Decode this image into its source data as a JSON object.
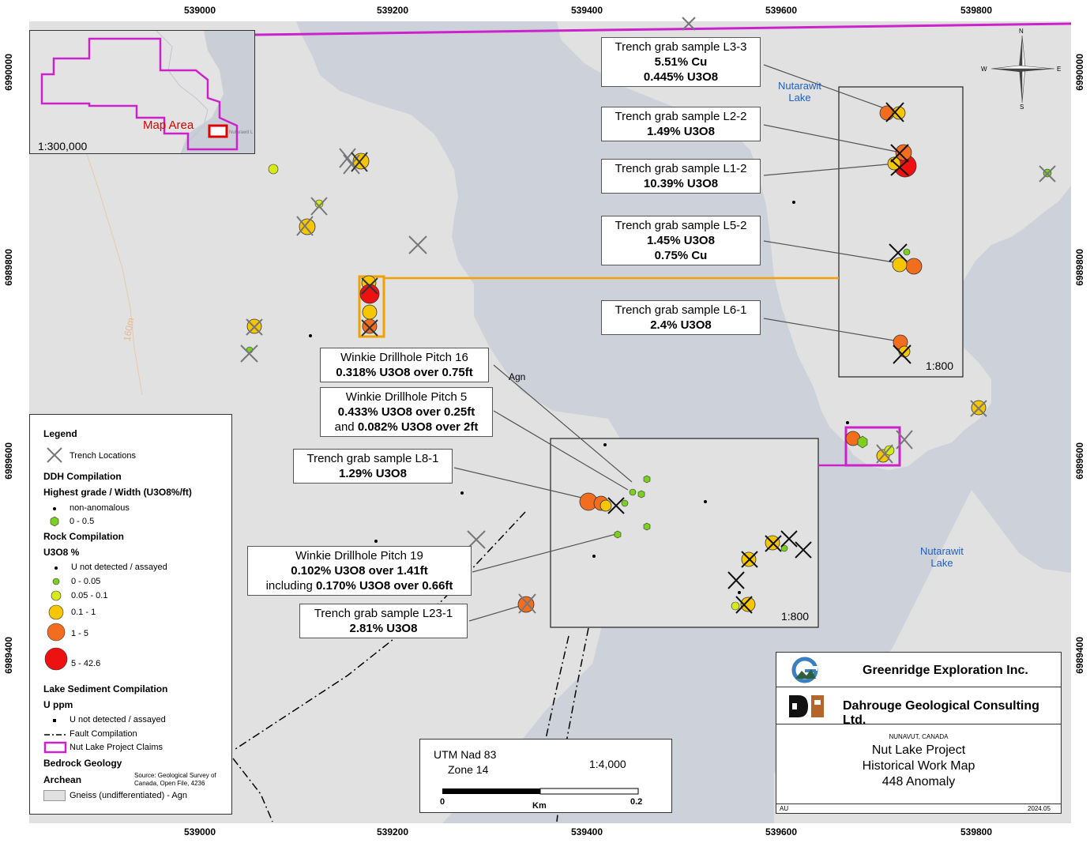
{
  "map": {
    "axis_x_labels": [
      "539000",
      "539200",
      "539400",
      "539600",
      "539800"
    ],
    "axis_y_labels": [
      "6990000",
      "6989800",
      "6989600",
      "6989400"
    ],
    "geology_label": "Agn",
    "contour_label": "160m",
    "lake_labels": [
      {
        "line1": "Nutarawit",
        "line2": "Lake"
      },
      {
        "line1": "Nutarawit",
        "line2": "Lake"
      }
    ],
    "inset_scale_1": "1:800",
    "inset_scale_2": "1:800"
  },
  "callouts": {
    "l3_3": {
      "title": "Trench grab sample L3-3",
      "line1": "5.51% Cu",
      "line2": "0.445% U3O8"
    },
    "l2_2": {
      "title": "Trench grab sample L2-2",
      "line1": "1.49% U3O8"
    },
    "l1_2": {
      "title": "Trench grab sample L1-2",
      "line1": "10.39% U3O8"
    },
    "l5_2": {
      "title": "Trench grab sample L5-2",
      "line1": "1.45% U3O8",
      "line2": "0.75% Cu"
    },
    "l6_1": {
      "title": "Trench grab sample L6-1",
      "line1": "2.4% U3O8"
    },
    "pitch16": {
      "title": "Winkie Drillhole Pitch 16",
      "line1": "0.318% U3O8 over 0.75ft"
    },
    "pitch5": {
      "title": "Winkie Drillhole Pitch 5",
      "line1": "0.433% U3O8 over 0.25ft",
      "line2_prefix": "and ",
      "line2_bold": "0.082% U3O8 over 2ft"
    },
    "l8_1": {
      "title": "Trench grab sample L8-1",
      "line1": "1.29% U3O8"
    },
    "pitch19": {
      "title": "Winkie Drillhole Pitch 19",
      "line1": "0.102% U3O8 over 1.41ft",
      "line2_prefix": "including ",
      "line2_bold": "0.170% U3O8 over 0.66ft"
    },
    "l23_1": {
      "title": "Trench grab sample L23-1",
      "line1": "2.81% U3O8"
    }
  },
  "inset_map": {
    "area_label": "Map Area",
    "scale": "1:300,000",
    "lake_label": "Nutarawit L"
  },
  "north_arrow": {
    "n": "N",
    "s": "S",
    "e": "E",
    "w": "W"
  },
  "legend": {
    "title": "Legend",
    "trench": "Trench Locations",
    "ddh_header": "DDH Compilation",
    "ddh_sub": "Highest grade / Width (U3O8%/ft)",
    "ddh_items": [
      "non-anomalous",
      "0 - 0.5"
    ],
    "rock_header": "Rock Compilation",
    "rock_sub": "U3O8 %",
    "rock_items": [
      "U not detected / assayed",
      "0 - 0.05",
      "0.05 - 0.1",
      "0.1 - 1",
      "1 - 5",
      "5 - 42.6"
    ],
    "lake_header": "Lake Sediment Compilation",
    "lake_sub": "U ppm",
    "lake_items": [
      "U not detected / assayed"
    ],
    "fault": "Fault Compilation",
    "claims": "Nut Lake Project Claims",
    "bedrock_header": "Bedrock Geology",
    "archean": "Archean",
    "source": "Source: Geological Survey of Canada, Open File, 4236",
    "gneiss": "Gneiss (undifferentiated) - Agn"
  },
  "scale_box": {
    "datum": "UTM Nad 83",
    "zone": "Zone 14",
    "scale": "1:4,000",
    "tick_0": "0",
    "tick_max": "0.2",
    "unit": "Km"
  },
  "title_block": {
    "company1": "Greenridge Exploration Inc.",
    "company2": "Dahrouge Geological Consulting Ltd.",
    "region": "NUNAVUT, CANADA",
    "project": "Nut Lake Project",
    "map_title": "Historical Work Map",
    "anomaly": "448 Anomaly",
    "author": "AU",
    "date": "2024.05"
  },
  "colors": {
    "land": "#e1e1e1",
    "water": "#cdd2da",
    "claims": "#cc22cc",
    "orange_line": "#f0a000",
    "grade_red": "#ee1111",
    "grade_orange": "#f36d1f",
    "grade_yellow": "#f6c600",
    "grade_lightyellow": "#d6ea1a",
    "grade_green": "#7bcf1f"
  }
}
